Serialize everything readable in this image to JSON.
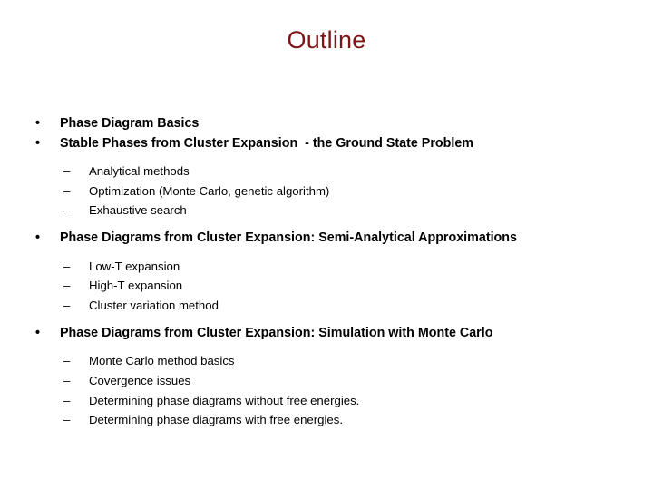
{
  "slide": {
    "title": "Outline",
    "title_color": "#7d1416",
    "text_color": "#000000",
    "background_color": "#ffffff",
    "bullet_marker": "•",
    "sub_bullet_marker": "–",
    "items": [
      {
        "level": 1,
        "text": "Phase Diagram Basics"
      },
      {
        "level": 1,
        "text": "Stable Phases from Cluster Expansion  - the Ground State Problem"
      },
      {
        "level": 2,
        "text": "Analytical methods"
      },
      {
        "level": 2,
        "text": "Optimization (Monte Carlo, genetic algorithm)"
      },
      {
        "level": 2,
        "text": "Exhaustive search"
      },
      {
        "level": 1,
        "text": "Phase Diagrams from Cluster Expansion: Semi-Analytical Approximations"
      },
      {
        "level": 2,
        "text": "Low-T expansion"
      },
      {
        "level": 2,
        "text": "High-T expansion"
      },
      {
        "level": 2,
        "text": "Cluster variation method"
      },
      {
        "level": 1,
        "text": "Phase Diagrams from Cluster Expansion: Simulation with Monte Carlo"
      },
      {
        "level": 2,
        "text": "Monte Carlo method basics"
      },
      {
        "level": 2,
        "text": "Covergence issues"
      },
      {
        "level": 2,
        "text": "Determining phase diagrams without free energies."
      },
      {
        "level": 2,
        "text": "Determining phase diagrams with free energies."
      }
    ]
  }
}
